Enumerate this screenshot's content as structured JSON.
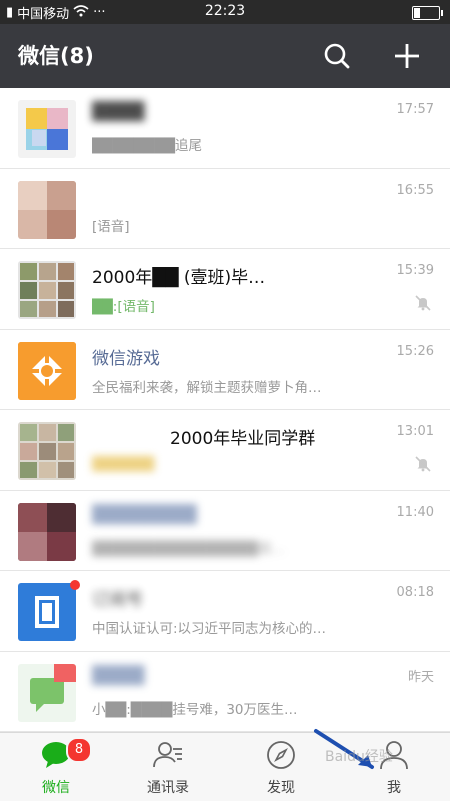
{
  "status_bar": {
    "carrier": "中国移动",
    "time": "22:23",
    "dots": "···"
  },
  "header": {
    "title": "微信(8)",
    "search_icon": "search-icon",
    "add_icon": "plus-icon"
  },
  "chats": [
    {
      "name": "████",
      "preview": "████████追尾",
      "time": "17:57",
      "muted": false
    },
    {
      "name": "",
      "preview": "[语音]",
      "time": "16:55",
      "muted": false
    },
    {
      "name": "2000年██ (壹班)毕…",
      "preview": "██:[语音]",
      "time": "15:39",
      "muted": true
    },
    {
      "name": "微信游戏",
      "preview": "全民福利来袭，解锁主题获赠萝卜角…",
      "time": "15:26",
      "muted": false
    },
    {
      "name": "2000年毕业同学群",
      "preview": "██████",
      "time": "13:01",
      "muted": true
    },
    {
      "name": "████████",
      "preview": "████████████████眉…",
      "time": "11:40",
      "muted": false
    },
    {
      "name": "订阅号",
      "preview": "中国认证认可:以习近平同志为核心的…",
      "time": "08:18",
      "muted": false
    },
    {
      "name": "████",
      "preview": "小██:████挂号难，30万医生…",
      "time": "昨天",
      "muted": false
    }
  ],
  "tabs": [
    {
      "label": "微信",
      "badge": "8",
      "active": true
    },
    {
      "label": "通讯录",
      "active": false
    },
    {
      "label": "发现",
      "active": false
    },
    {
      "label": "我",
      "active": false
    }
  ],
  "watermark": "Baidu经验",
  "colors": {
    "header_bg": "#393a3f",
    "active_green": "#1aad19",
    "badge_red": "#f43530",
    "game_orange": "#f79c2e",
    "sub_blue": "#2f7cd9"
  }
}
